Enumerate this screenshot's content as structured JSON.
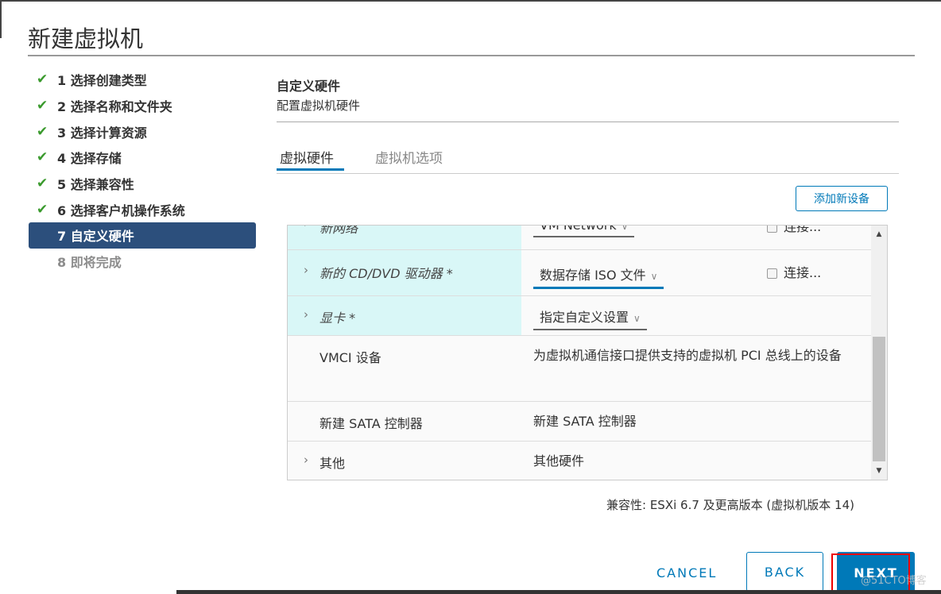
{
  "dialog": {
    "title": "新建虚拟机"
  },
  "steps": [
    {
      "label": "1 选择创建类型",
      "done": true
    },
    {
      "label": "2 选择名称和文件夹",
      "done": true
    },
    {
      "label": "3 选择计算资源",
      "done": true
    },
    {
      "label": "4 选择存储",
      "done": true
    },
    {
      "label": "5 选择兼容性",
      "done": true
    },
    {
      "label": "6 选择客户机操作系统",
      "done": true
    },
    {
      "label": "7 自定义硬件",
      "active": true
    },
    {
      "label": "8 即将完成"
    }
  ],
  "section": {
    "title": "自定义硬件",
    "subtitle": "配置虚拟机硬件"
  },
  "tabs": [
    {
      "label": "虚拟硬件",
      "active": true
    },
    {
      "label": "虚拟机选项"
    }
  ],
  "add_device_label": "添加新设备",
  "rows": [
    {
      "label": "新网络",
      "value": "VM Network",
      "connect": "连接..."
    },
    {
      "label": "新的 CD/DVD 驱动器 *",
      "value": "数据存储 ISO 文件",
      "connect": "连接..."
    },
    {
      "label": "显卡 *",
      "value": "指定自定义设置"
    },
    {
      "label": "VMCI 设备",
      "value": "为虚拟机通信接口提供支持的虚拟机 PCI 总线上的设备"
    },
    {
      "label": "新建 SATA 控制器",
      "value": "新建 SATA 控制器"
    },
    {
      "label": "其他",
      "value": "其他硬件"
    }
  ],
  "compatibility": "兼容性: ESXi 6.7 及更高版本 (虚拟机版本 14)",
  "buttons": {
    "cancel": "CANCEL",
    "back": "BACK",
    "next": "NEXT"
  },
  "watermark": "@51CTO博客",
  "colors": {
    "accent": "#0079b8",
    "active_step": "#2c4f7c",
    "check": "#3a9a2d",
    "row_highlight": "#d9f7f7"
  }
}
